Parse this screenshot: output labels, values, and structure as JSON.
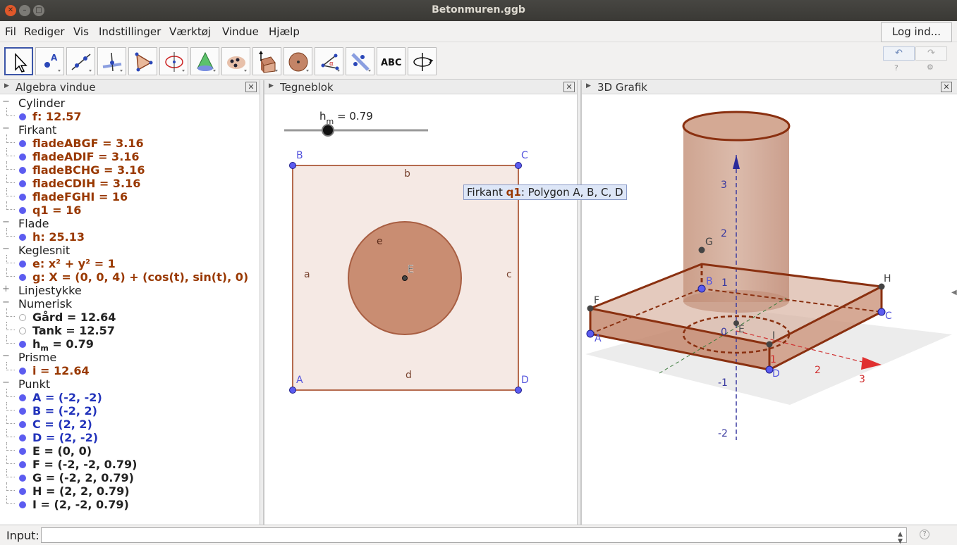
{
  "window": {
    "title": "Betonmuren.ggb"
  },
  "menu": [
    "Fil",
    "Rediger",
    "Vis",
    "Indstillinger",
    "Værktøj",
    "Vindue",
    "Hjælp"
  ],
  "login_label": "Log ind...",
  "toolbar": {
    "tools": [
      "move-tool-icon",
      "point-tool-icon",
      "line-tool-icon",
      "perpendicular-tool-icon",
      "polygon-tool-icon",
      "circle-axis-tool-icon",
      "intersect-surfaces-tool-icon",
      "pyramid-tool-icon",
      "extrude-tool-icon",
      "sphere-tool-icon",
      "angle-tool-icon",
      "reflect-tool-icon",
      "text-tool-icon",
      "rotate-view-tool-icon"
    ],
    "text_tool_label": "ABC",
    "undo_symbol": "↶",
    "redo_symbol": "↷"
  },
  "algebra": {
    "title": "Algebra vindue",
    "groups": [
      {
        "label": "Cylinder",
        "expanded": true,
        "items": [
          {
            "text": "f: 12.57",
            "color": "brown",
            "visible": true
          }
        ]
      },
      {
        "label": "Firkant",
        "expanded": true,
        "items": [
          {
            "text": "fladeABGF = 3.16",
            "color": "brown",
            "visible": true
          },
          {
            "text": "fladeADIF = 3.16",
            "color": "brown",
            "visible": true
          },
          {
            "text": "fladeBCHG = 3.16",
            "color": "brown",
            "visible": true
          },
          {
            "text": "fladeCDIH = 3.16",
            "color": "brown",
            "visible": true
          },
          {
            "text": "fladeFGHI = 16",
            "color": "brown",
            "visible": true
          },
          {
            "text": "q1 = 16",
            "color": "brown",
            "visible": true
          }
        ]
      },
      {
        "label": "Flade",
        "expanded": true,
        "items": [
          {
            "text": "h: 25.13",
            "color": "brown",
            "visible": true
          }
        ]
      },
      {
        "label": "Keglesnit",
        "expanded": true,
        "items": [
          {
            "text": "e: x² + y² = 1",
            "color": "brown",
            "visible": true
          },
          {
            "text": "g: X = (0, 0, 4) + (cos(t), sin(t), 0)",
            "color": "brown",
            "visible": true
          }
        ]
      },
      {
        "label": "Linjestykke",
        "expanded": false,
        "items": []
      },
      {
        "label": "Numerisk",
        "expanded": true,
        "items": [
          {
            "text": "Gård = 12.64",
            "color": "dark",
            "visible": false
          },
          {
            "text": "Tank = 12.57",
            "color": "dark",
            "visible": false
          },
          {
            "text": "hm = 0.79",
            "color": "dark",
            "visible": true,
            "subscript": true
          }
        ]
      },
      {
        "label": "Prisme",
        "expanded": true,
        "items": [
          {
            "text": "i = 12.64",
            "color": "brown",
            "visible": true
          }
        ]
      },
      {
        "label": "Punkt",
        "expanded": true,
        "items": [
          {
            "text": "A = (-2, -2)",
            "color": "blue",
            "visible": true
          },
          {
            "text": "B = (-2, 2)",
            "color": "blue",
            "visible": true
          },
          {
            "text": "C = (2, 2)",
            "color": "blue",
            "visible": true
          },
          {
            "text": "D = (2, -2)",
            "color": "blue",
            "visible": true
          },
          {
            "text": "E = (0, 0)",
            "color": "dark",
            "visible": true
          },
          {
            "text": "F = (-2, -2, 0.79)",
            "color": "dark",
            "visible": true
          },
          {
            "text": "G = (-2, 2, 0.79)",
            "color": "dark",
            "visible": true
          },
          {
            "text": "H = (2, 2, 0.79)",
            "color": "dark",
            "visible": true
          },
          {
            "text": "I = (2, -2, 0.79)",
            "color": "dark",
            "visible": true
          }
        ]
      }
    ]
  },
  "graphics": {
    "title": "Tegneblok",
    "slider": {
      "label_main": "h",
      "label_sub": "m",
      "value_text": " = 0.79",
      "value": 0.79
    },
    "points": [
      "A",
      "B",
      "C",
      "D",
      "E"
    ],
    "segments": [
      "a",
      "b",
      "c",
      "d"
    ],
    "circle_label": "e",
    "tooltip": {
      "prefix": "Firkant ",
      "name": "q1",
      "rest": ": Polygon A, B, C, D"
    }
  },
  "view3d": {
    "title": "3D Grafik",
    "z_ticks": [
      "3",
      "2",
      "1",
      "0",
      "-1",
      "-2"
    ],
    "x_ticks": [
      "1",
      "2",
      "3"
    ],
    "points": [
      "A",
      "B",
      "C",
      "D",
      "E",
      "F",
      "G",
      "H",
      "I"
    ]
  },
  "input": {
    "label": "Input:",
    "help": "?"
  },
  "colors": {
    "accent": "#3c55a8",
    "brown": "#993800",
    "point_blue": "#5c5cf0",
    "fill": "#c6896d"
  }
}
